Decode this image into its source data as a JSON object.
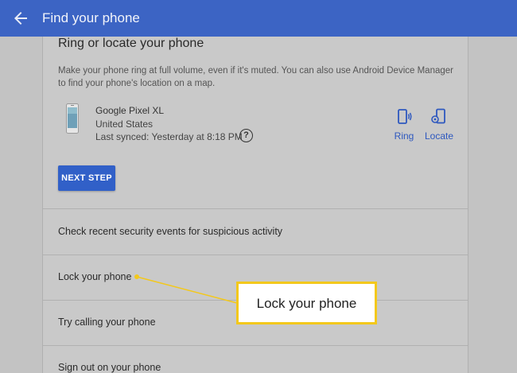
{
  "appbar": {
    "title": "Find your phone",
    "back_icon": "arrow-left-icon",
    "color": "#3c64c4"
  },
  "ring_locate": {
    "title": "Ring or locate your phone",
    "description": "Make your phone ring at full volume, even if it's muted. You can also use Android Device Manager to find your phone's location on a map.",
    "device": {
      "name": "Google Pixel XL",
      "country": "United States",
      "last_synced": "Last synced: Yesterday at 8:18 PM",
      "help_label": "?"
    },
    "actions": {
      "ring_label": "Ring",
      "ring_icon": "phone-ring-icon",
      "locate_label": "Locate",
      "locate_icon": "phone-locate-icon",
      "accent": "#2e58bf"
    },
    "next_step_label": "NEXT STEP"
  },
  "options": [
    {
      "label": "Check recent security events for suspicious activity"
    },
    {
      "label": "Lock your phone"
    },
    {
      "label": "Try calling your phone"
    },
    {
      "label": "Sign out on your phone"
    }
  ],
  "callout": {
    "text": "Lock your phone",
    "border_color": "#f3c81b"
  }
}
